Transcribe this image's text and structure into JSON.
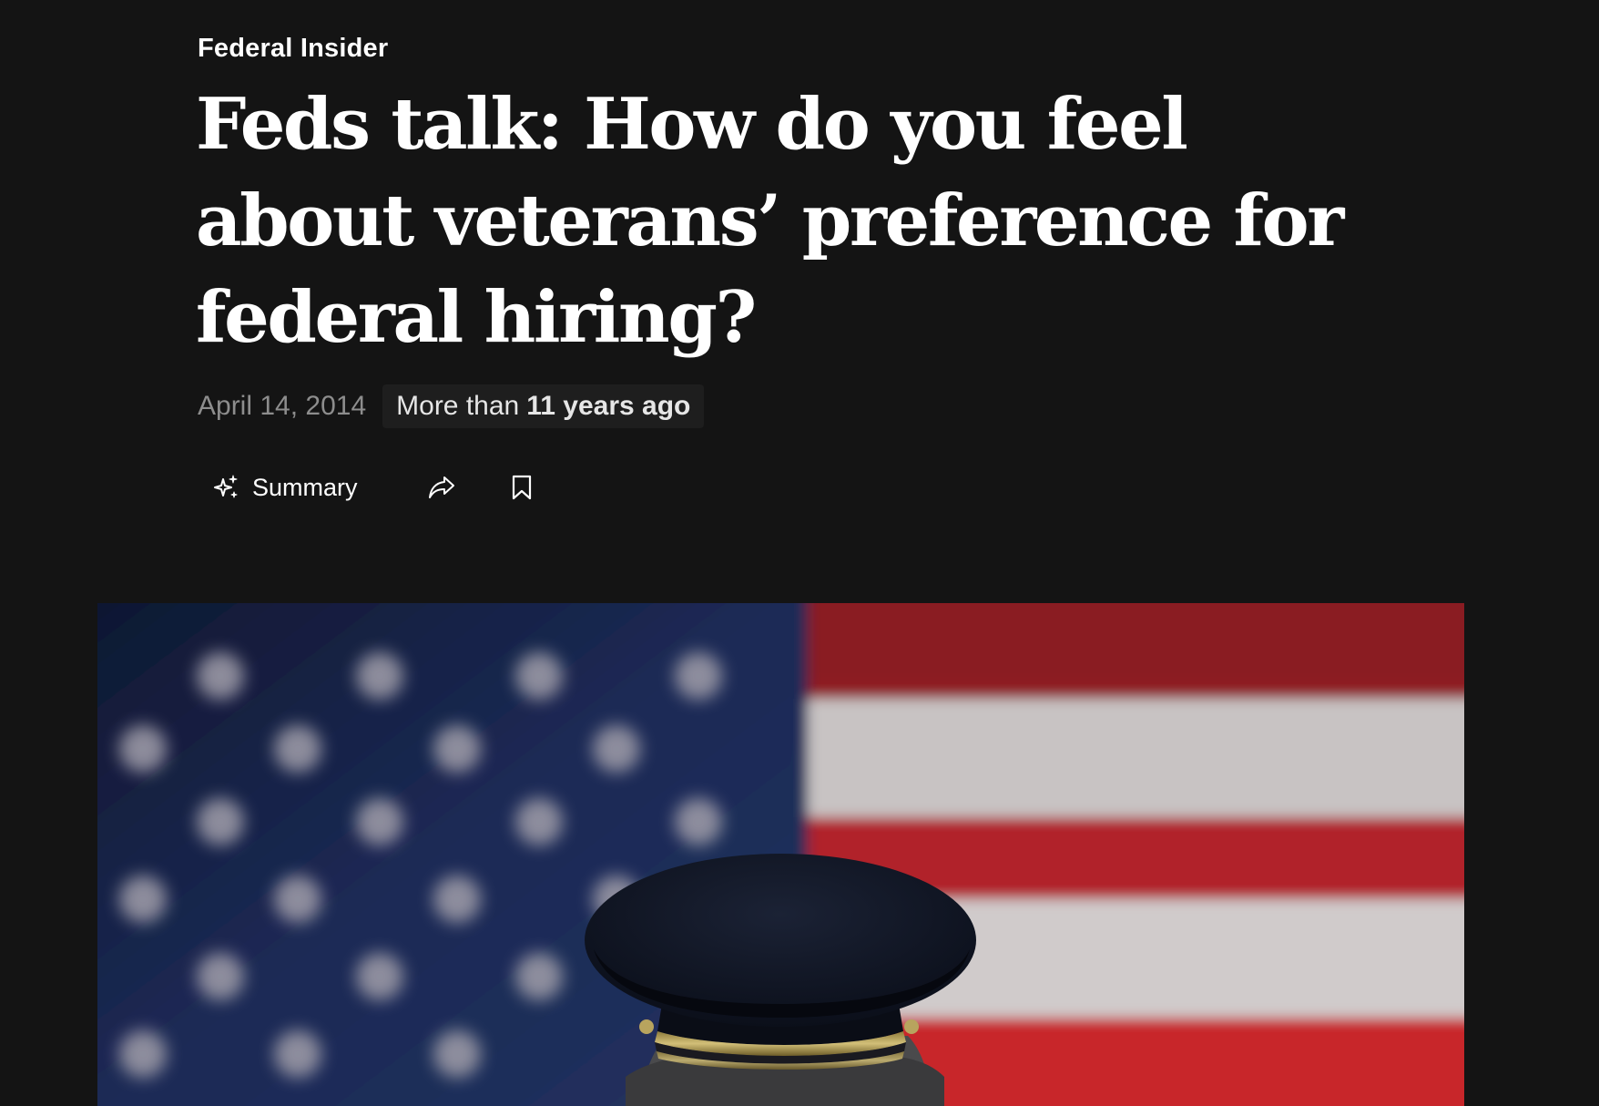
{
  "article": {
    "section_label": "Federal Insider",
    "headline": "Feds talk: How do you feel about veterans’ preference for federal hiring?",
    "date": "April 14, 2014",
    "age_prefix": "More than",
    "age_value": "11 years ago"
  },
  "actions": {
    "summary_label": "Summary",
    "summary_icon": "sparkle-icon",
    "share_icon": "share-icon",
    "bookmark_icon": "bookmark-icon"
  },
  "hero_image": {
    "subject": "uniformed officer's cap in front of blurred American flag"
  },
  "colors": {
    "background": "#141414",
    "text": "#ffffff",
    "date_text": "#8d8d8d",
    "badge_background": "#1e1e1e"
  }
}
